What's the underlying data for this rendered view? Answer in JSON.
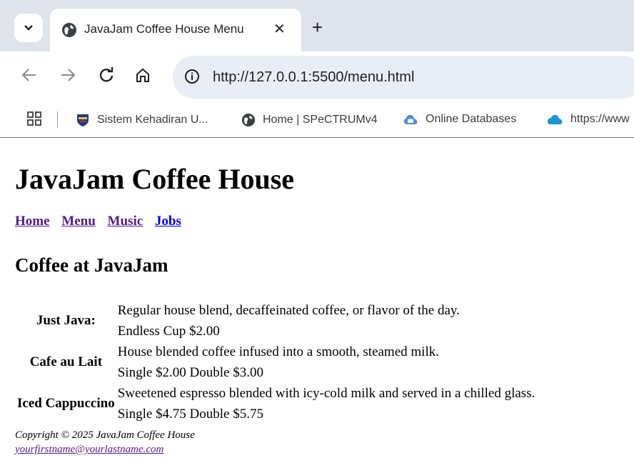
{
  "browser": {
    "tab_title": "JavaJam Coffee House Menu",
    "tab_close": "✕",
    "new_tab": "+",
    "url": "http://127.0.0.1:5500/menu.html",
    "bookmarks": [
      {
        "label": "Sistem Kehadiran U...",
        "icon": "shield-crest-icon"
      },
      {
        "label": "Home | SPeCTRUMv4",
        "icon": "globe-icon"
      },
      {
        "label": "Online Databases",
        "icon": "database-cloud-icon"
      },
      {
        "label": "https://www",
        "icon": "salesforce-cloud-icon"
      }
    ]
  },
  "page": {
    "site_title": "JavaJam Coffee House",
    "nav": [
      {
        "label": "Home",
        "state": "visited"
      },
      {
        "label": "Menu",
        "state": "visited"
      },
      {
        "label": "Music",
        "state": "visited"
      },
      {
        "label": "Jobs",
        "state": "unvisited"
      }
    ],
    "section_title": "Coffee at JavaJam",
    "menu": [
      {
        "name": "Just Java:",
        "description": "Regular house blend, decaffeinated coffee, or flavor of the day.",
        "price": "Endless Cup $2.00"
      },
      {
        "name": "Cafe au Lait",
        "description": "House blended coffee infused into a smooth, steamed milk.",
        "price": "Single $2.00 Double $3.00"
      },
      {
        "name": "Iced Cappuccino",
        "description": "Sweetened espresso blended with icy-cold milk and served in a chilled glass.",
        "price": "Single $4.75 Double $5.75"
      }
    ],
    "footer": {
      "copyright": "Copyright © 2025 JavaJam Coffee House",
      "email": "yourfirstname@yourlastname.com"
    }
  },
  "colors": {
    "tabstrip": "#dfe3eb",
    "omnibox": "#e9edf5",
    "visited_link": "#551a8b",
    "unvisited_link": "#0000ee"
  }
}
